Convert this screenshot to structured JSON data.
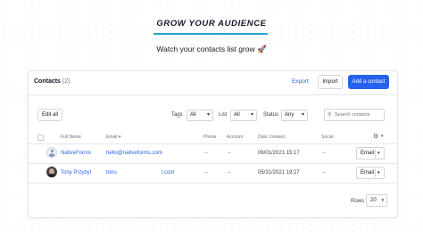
{
  "hero": {
    "title": "GROW YOUR AUDIENCE",
    "subtitle": "Watch your contacts list grow 🚀"
  },
  "contacts": {
    "title": "Contacts",
    "count": "(2)",
    "export_label": "Export",
    "import_label": "Import",
    "add_label": "Add a contact",
    "edit_all_label": "Edit all"
  },
  "filters": {
    "tags": {
      "label": "Tags",
      "value": "All"
    },
    "list": {
      "label": "List",
      "value": "All"
    },
    "status": {
      "label": "Status",
      "value": "Any"
    },
    "search_placeholder": "Search contacts"
  },
  "table": {
    "columns": [
      "Full Name",
      "Email",
      "Phone",
      "Account",
      "Date Created",
      "Social"
    ],
    "rows": [
      {
        "name": "NativeForms",
        "email": "hello@nativeforms.com",
        "phone": "--",
        "account": "--",
        "date": "06/01/2021 15:17",
        "social": "--",
        "action": "Email",
        "avatar": "default-avatar-icon"
      },
      {
        "name": "Tony Przybyl",
        "email_part1": "tonu",
        "email_part2": "l.com",
        "phone": "--",
        "account": "--",
        "date": "05/31/2021 19:27",
        "social": "--",
        "action": "Email",
        "avatar": "user-photo"
      }
    ]
  },
  "pagination": {
    "rows_label": "Rows",
    "rows_value": "20"
  },
  "colors": {
    "accent": "#2563eb",
    "underline": "#22a6c9"
  }
}
